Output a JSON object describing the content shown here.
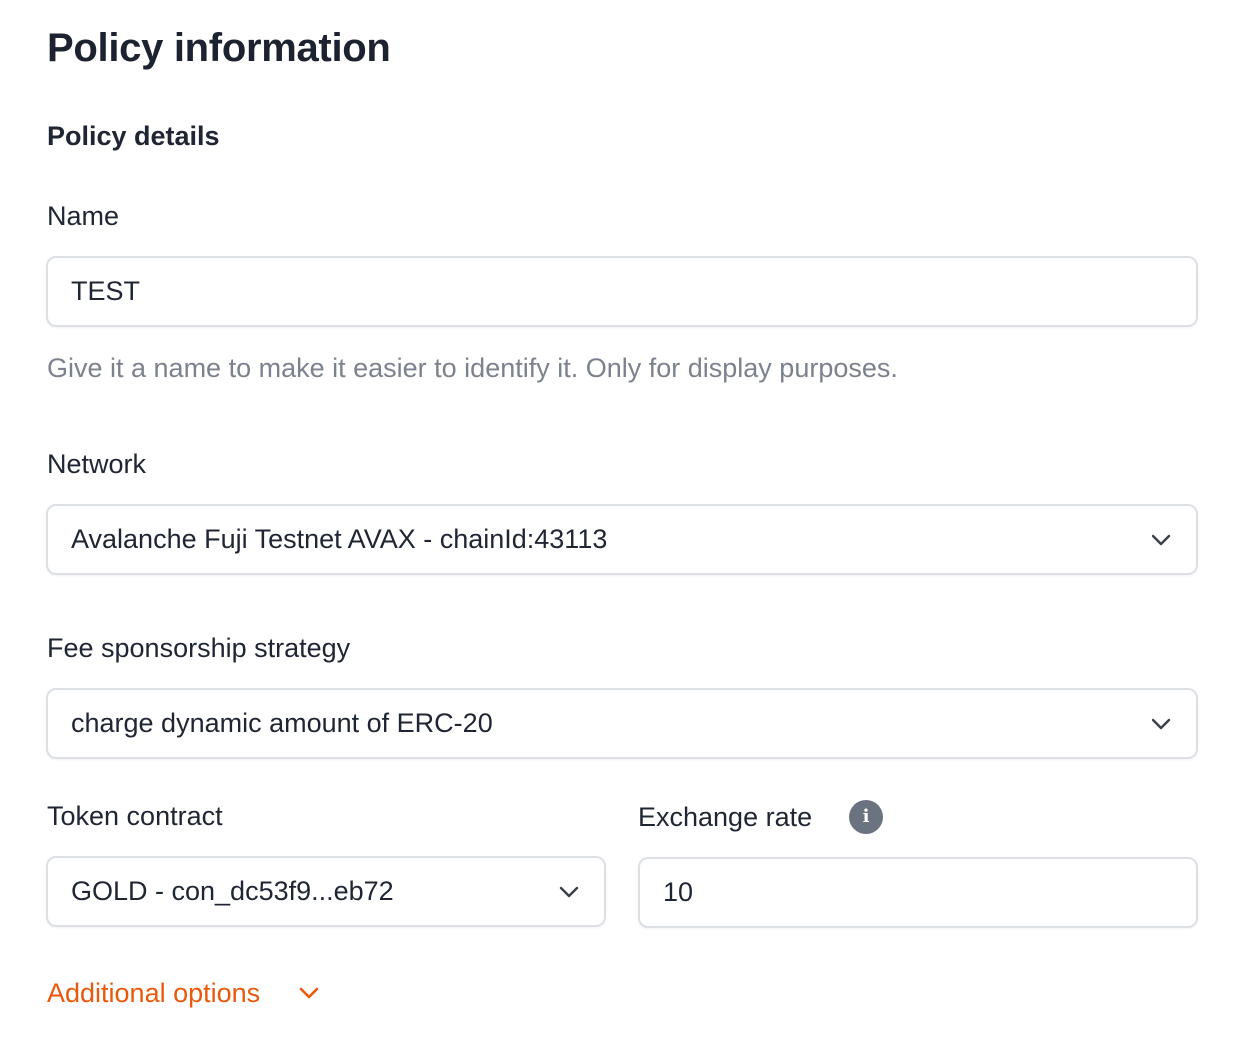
{
  "page": {
    "title": "Policy information"
  },
  "policy_details": {
    "section_title": "Policy details",
    "name": {
      "label": "Name",
      "value": "TEST",
      "helper": "Give it a name to make it easier to identify it. Only for display purposes."
    },
    "network": {
      "label": "Network",
      "selected": "Avalanche Fuji Testnet AVAX - chainId:43113"
    },
    "fee_strategy": {
      "label": "Fee sponsorship strategy",
      "selected": "charge dynamic amount of ERC-20"
    },
    "token_contract": {
      "label": "Token contract",
      "selected": "GOLD - con_dc53f9...eb72"
    },
    "exchange_rate": {
      "label": "Exchange rate",
      "value": "10",
      "info_icon": "info-icon"
    },
    "additional_options": {
      "label": "Additional options",
      "icon": "chevron-down-icon"
    }
  },
  "colors": {
    "accent": "#ea580c",
    "text_primary": "#1f2533",
    "text_muted": "#7c828d",
    "border": "#dcdfe4",
    "info_icon_bg": "#6b7280"
  }
}
